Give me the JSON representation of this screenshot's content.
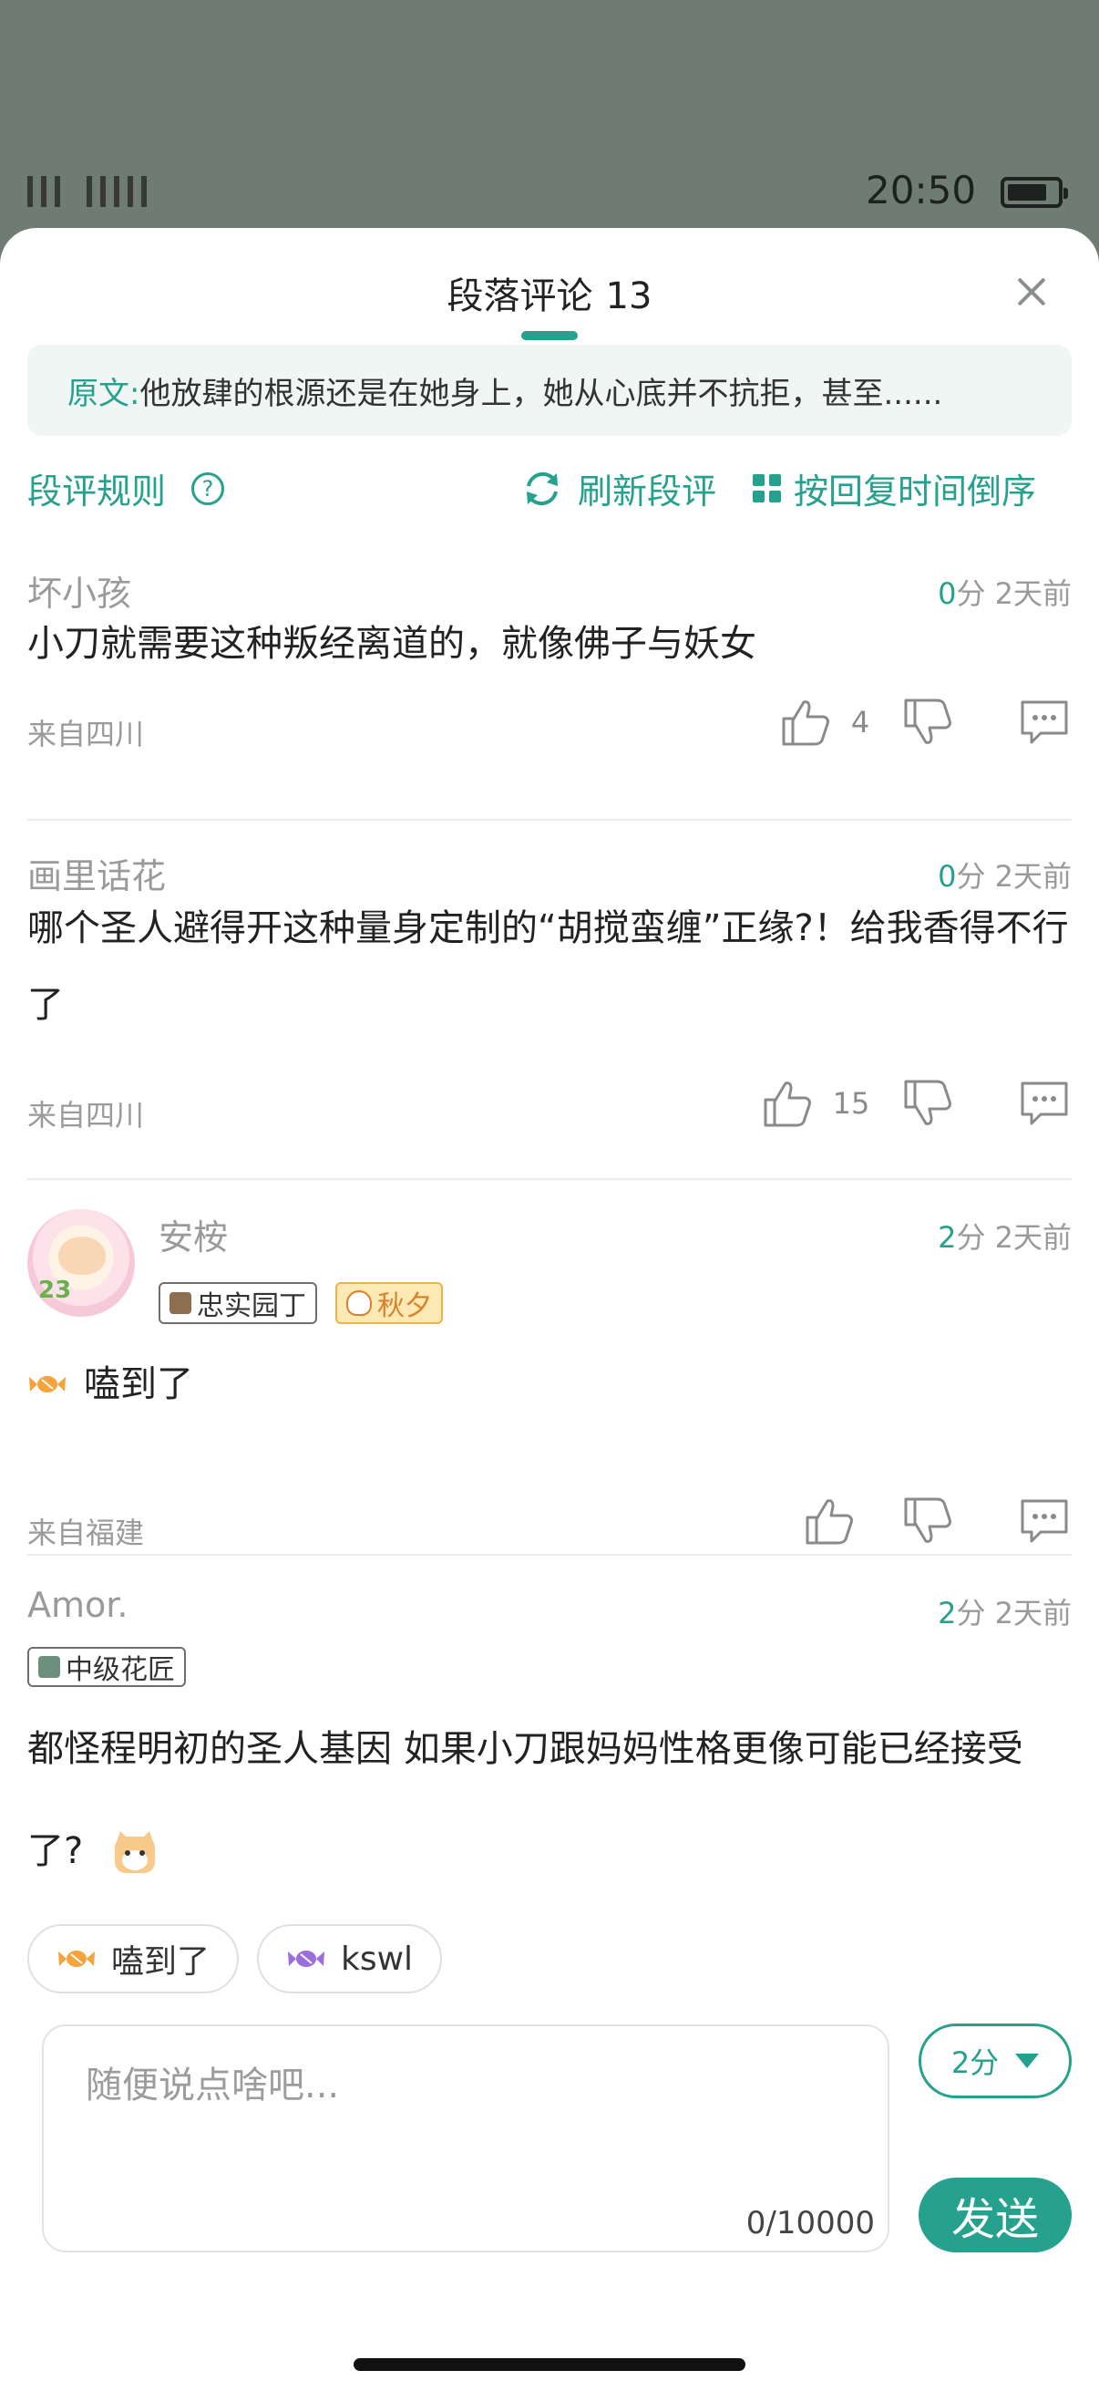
{
  "status_bar": {
    "time": "20:50"
  },
  "sheet": {
    "title": "段落评论",
    "count": "13",
    "quote_label": "原文:",
    "quote_text": "他放肆的根源还是在她身上，她从心底并不抗拒，甚至......"
  },
  "toolbar": {
    "rules_label": "段评规则",
    "help_glyph": "?",
    "refresh_label": "刷新段评",
    "sort_label": "按回复时间倒序"
  },
  "comments": [
    {
      "name": "坏小孩",
      "score": "0",
      "score_unit": "分",
      "time": "2天前",
      "text": "小刀就需要这种叛经离道的，就像佛子与妖女",
      "location": "来自四川",
      "likes": "4"
    },
    {
      "name": "画里话花",
      "score": "0",
      "score_unit": "分",
      "time": "2天前",
      "text": "哪个圣人避得开这种量身定制的“胡搅蛮缠”正缘?！给我香得不行了",
      "location": "来自四川",
      "likes": "15"
    },
    {
      "name": "安桉",
      "avatar_num": "23",
      "badge1": "忠实园丁",
      "badge2": "秋夕",
      "score": "2",
      "score_unit": "分",
      "time": "2天前",
      "text": "嗑到了",
      "location": "来自福建",
      "likes": ""
    },
    {
      "name": "Amor.",
      "badge1": "中级花匠",
      "score": "2",
      "score_unit": "分",
      "time": "2天前",
      "text": "都怪程明初的圣人基因 如果小刀跟妈妈性格更像可能已经接受了?"
    }
  ],
  "quick_replies": [
    {
      "label": "嗑到了",
      "icon": "candy-orange-icon"
    },
    {
      "label": "kswl",
      "icon": "candy-purple-icon"
    }
  ],
  "composer": {
    "placeholder": "随便说点啥吧...",
    "char_count": "0/10000",
    "score_value": "2分",
    "send_label": "发送"
  },
  "colors": {
    "accent": "#25a18e",
    "muted": "#9a9a9a"
  }
}
